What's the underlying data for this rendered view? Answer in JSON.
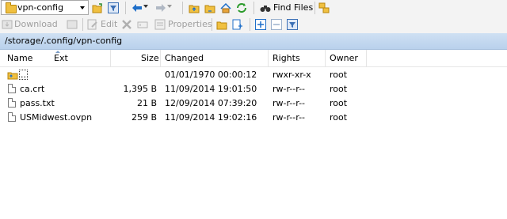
{
  "toolbar": {
    "location": "vpn-config",
    "find_files_label": "Find Files",
    "download_label": "Download",
    "edit_label": "Edit",
    "properties_label": "Properties"
  },
  "path_bar": {
    "path": "/storage/.config/vpn-config"
  },
  "columns": {
    "name": "Name",
    "ext": "Ext",
    "size": "Size",
    "changed": "Changed",
    "rights": "Rights",
    "owner": "Owner"
  },
  "files": [
    {
      "name": "..",
      "size": "",
      "changed": "01/01/1970 00:00:12",
      "rights": "rwxr-xr-x",
      "owner": "root"
    },
    {
      "name": "ca.crt",
      "size": "1,395 B",
      "changed": "11/09/2014 19:01:50",
      "rights": "rw-r--r--",
      "owner": "root"
    },
    {
      "name": "pass.txt",
      "size": "21 B",
      "changed": "12/09/2014 07:39:20",
      "rights": "rw-r--r--",
      "owner": "root"
    },
    {
      "name": "USMidwest.ovpn",
      "size": "259 B",
      "changed": "11/09/2014 19:02:16",
      "rights": "rw-r--r--",
      "owner": "root"
    }
  ],
  "colors": {
    "path_bar": "#c6d9f0",
    "folder": "#f0c040",
    "accent": "#1f6fc9"
  }
}
